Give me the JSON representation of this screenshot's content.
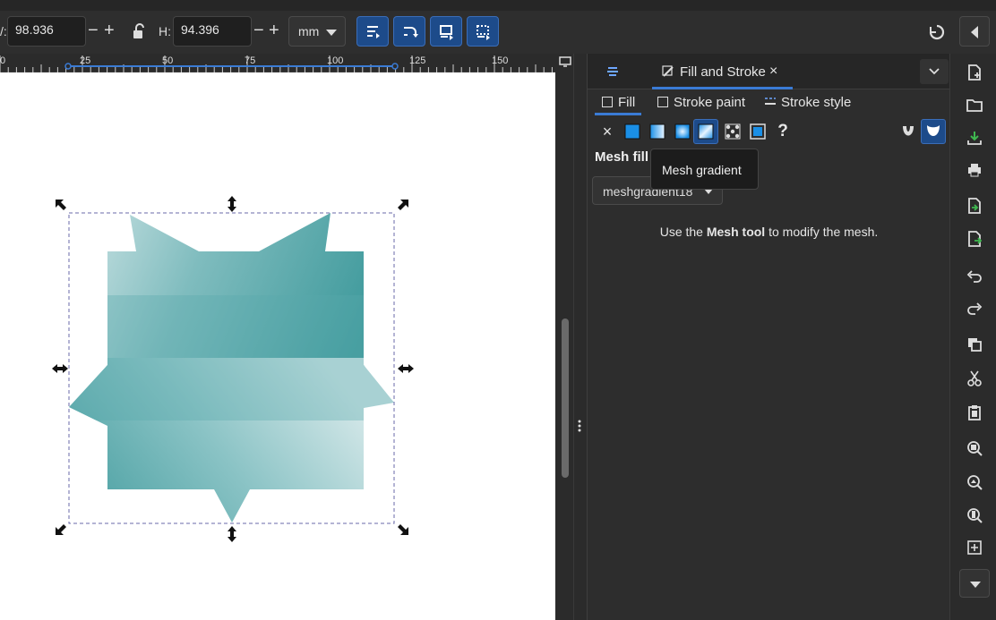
{
  "toolbar": {
    "w_label_partial": "/:",
    "w_value": "98.936",
    "h_label": "H:",
    "h_value": "94.396",
    "units": "mm",
    "minus": "−",
    "plus": "+"
  },
  "ruler": {
    "ticks": [
      "0",
      "25",
      "50",
      "75",
      "100",
      "125",
      "150"
    ]
  },
  "panel": {
    "tab_title": "Fill and Stroke",
    "close_glyph": "×",
    "subtabs": {
      "fill": "Fill",
      "stroke_paint": "Stroke paint",
      "stroke_style": "Stroke style"
    },
    "paint_buttons": [
      {
        "icon": "no-paint-icon",
        "glyph": "×"
      },
      {
        "icon": "flat-color-icon"
      },
      {
        "icon": "linear-gradient-icon"
      },
      {
        "icon": "radial-gradient-icon"
      },
      {
        "icon": "mesh-gradient-icon",
        "active": true
      },
      {
        "icon": "pattern-icon"
      },
      {
        "icon": "swatch-icon"
      },
      {
        "icon": "unset-paint-icon",
        "glyph": "?"
      }
    ],
    "section_title": "Mesh fill",
    "mesh_select": "meshgradient18",
    "hint_prefix": "Use the ",
    "hint_bold": "Mesh tool",
    "hint_suffix": " to modify the mesh.",
    "tooltip": "Mesh gradient"
  },
  "colors": {
    "accent": "#1d4b8a",
    "accent_border": "#3a6db8",
    "mesh_dark": "#3f9a9c",
    "mesh_light": "#d3e7e8"
  }
}
